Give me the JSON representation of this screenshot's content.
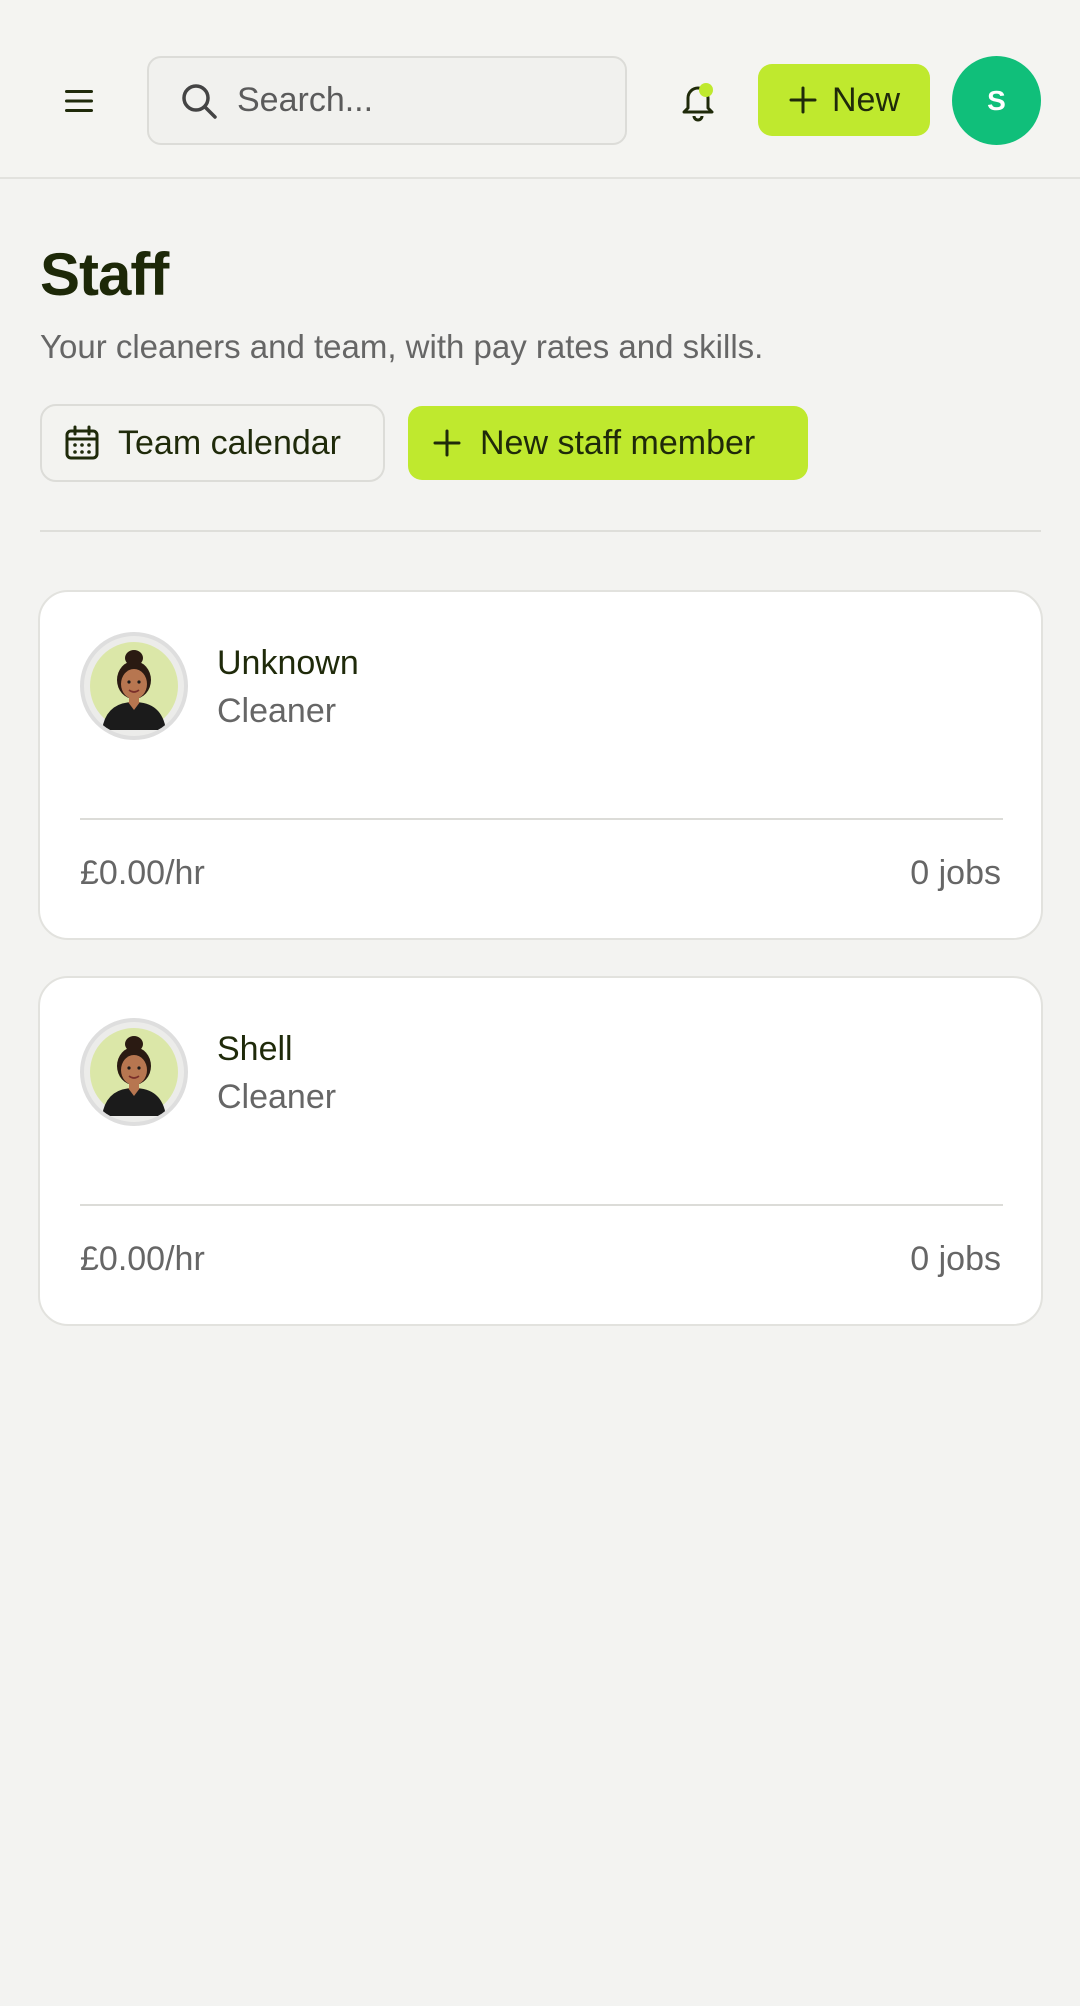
{
  "header": {
    "search_placeholder": "Search...",
    "new_label": "New",
    "avatar_initial": "S"
  },
  "page": {
    "title": "Staff",
    "subtitle": "Your cleaners and team, with pay rates and skills.",
    "team_calendar_label": "Team calendar",
    "new_staff_label": "New staff member"
  },
  "staff": [
    {
      "name": "Unknown",
      "role": "Cleaner",
      "rate": "£0.00/hr",
      "jobs": "0 jobs"
    },
    {
      "name": "Shell",
      "role": "Cleaner",
      "rate": "£0.00/hr",
      "jobs": "0 jobs"
    }
  ],
  "colors": {
    "accent": "#bfe92e",
    "avatar": "#10bf7a",
    "background": "#f3f3f1"
  },
  "icons": {
    "menu": "hamburger-icon",
    "search": "search-icon",
    "bell": "bell-icon",
    "plus": "plus-icon",
    "calendar": "calendar-icon"
  }
}
